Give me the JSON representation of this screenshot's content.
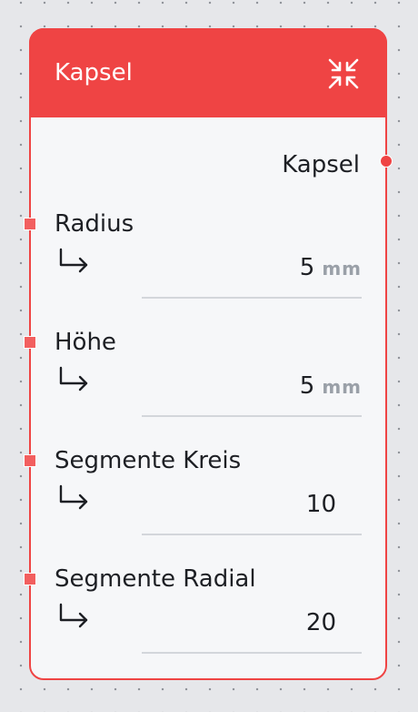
{
  "node": {
    "title": "Kapsel",
    "collapse_icon": "collapse-icon",
    "output_label": "Kapsel",
    "accent_color": "#ef4444",
    "params": [
      {
        "label": "Radius",
        "value": "5",
        "unit": "mm"
      },
      {
        "label": "Höhe",
        "value": "5",
        "unit": "mm"
      },
      {
        "label": "Segmente Kreis",
        "value": "10",
        "unit": ""
      },
      {
        "label": "Segmente Radial",
        "value": "20",
        "unit": ""
      }
    ]
  }
}
